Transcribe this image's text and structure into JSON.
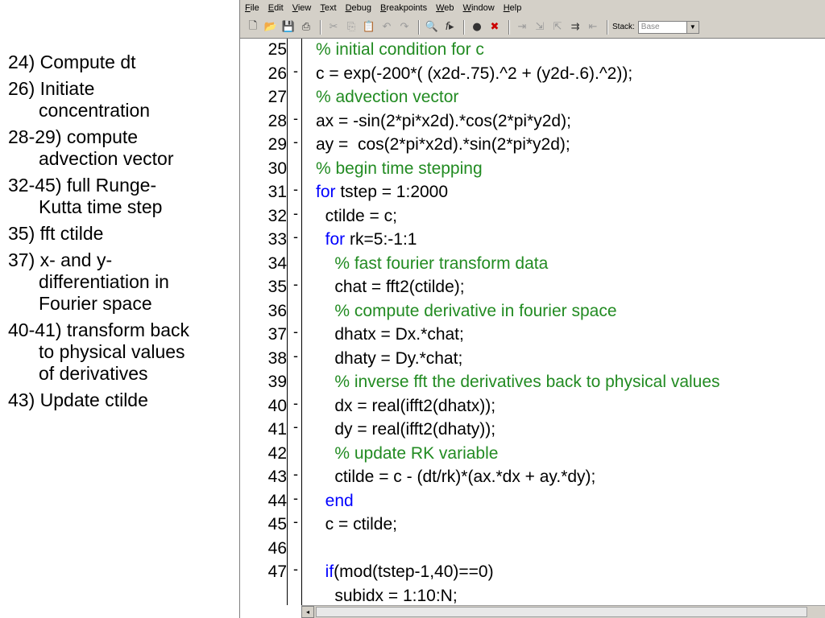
{
  "notes": [
    "24) Compute dt",
    "26) Initiate\nconcentration",
    "28-29) compute\nadvection vector",
    "32-45) full Runge-\nKutta time step",
    "35) fft ctilde",
    "37) x- and y-\ndifferentiation in\nFourier space",
    "40-41) transform back\nto physical values\nof derivatives",
    "43) Update ctilde"
  ],
  "menu": [
    "File",
    "Edit",
    "View",
    "Text",
    "Debug",
    "Breakpoints",
    "Web",
    "Window",
    "Help"
  ],
  "toolbar": {
    "icons": [
      "new-file-icon",
      "open-folder-icon",
      "save-icon",
      "print-icon",
      "cut-icon",
      "copy-icon",
      "paste-icon",
      "undo-icon",
      "redo-icon",
      "find-icon",
      "function-icon",
      "set-breakpoint-icon",
      "clear-breakpoint-icon",
      "step-icon",
      "step-in-icon",
      "step-out-icon",
      "continue-icon",
      "exit-debug-icon"
    ],
    "stack_label": "Stack:",
    "stack_value": "Base"
  },
  "code": {
    "lines": [
      {
        "n": "25",
        "mark": "",
        "text": "% initial condition for c",
        "kind": "comment"
      },
      {
        "n": "26",
        "mark": "-",
        "text": "c = exp(-200*( (x2d-.75).^2 + (y2d-.6).^2));",
        "kind": "code"
      },
      {
        "n": "27",
        "mark": "",
        "text": "% advection vector",
        "kind": "comment"
      },
      {
        "n": "28",
        "mark": "-",
        "text": "ax = -sin(2*pi*x2d).*cos(2*pi*y2d);",
        "kind": "code"
      },
      {
        "n": "29",
        "mark": "-",
        "text": "ay =  cos(2*pi*x2d).*sin(2*pi*y2d);",
        "kind": "code"
      },
      {
        "n": "30",
        "mark": "",
        "text": "% begin time stepping",
        "kind": "comment"
      },
      {
        "n": "31",
        "mark": "-",
        "kw": "for",
        "text": " tstep = 1:2000",
        "kind": "code"
      },
      {
        "n": "32",
        "mark": "-",
        "text": "  ctilde = c;",
        "kind": "code"
      },
      {
        "n": "33",
        "mark": "-",
        "kw": "  for",
        "text": " rk=5:-1:1",
        "kind": "code"
      },
      {
        "n": "34",
        "mark": "",
        "text": "    % fast fourier transform data",
        "kind": "comment"
      },
      {
        "n": "35",
        "mark": "-",
        "text": "    chat = fft2(ctilde);",
        "kind": "code"
      },
      {
        "n": "36",
        "mark": "",
        "text": "    % compute derivative in fourier space",
        "kind": "comment"
      },
      {
        "n": "37",
        "mark": "-",
        "text": "    dhatx = Dx.*chat;",
        "kind": "code"
      },
      {
        "n": "38",
        "mark": "-",
        "text": "    dhaty = Dy.*chat;",
        "kind": "code"
      },
      {
        "n": "39",
        "mark": "",
        "text": "    % inverse fft the derivatives back to physical values",
        "kind": "comment"
      },
      {
        "n": "40",
        "mark": "-",
        "text": "    dx = real(ifft2(dhatx));",
        "kind": "code"
      },
      {
        "n": "41",
        "mark": "-",
        "text": "    dy = real(ifft2(dhaty));",
        "kind": "code"
      },
      {
        "n": "42",
        "mark": "",
        "text": "    % update RK variable",
        "kind": "comment"
      },
      {
        "n": "43",
        "mark": "-",
        "text": "    ctilde = c - (dt/rk)*(ax.*dx + ay.*dy);",
        "kind": "code"
      },
      {
        "n": "44",
        "mark": "-",
        "kw": "  end",
        "text": "",
        "kind": "code"
      },
      {
        "n": "45",
        "mark": "-",
        "text": "  c = ctilde;",
        "kind": "code"
      },
      {
        "n": "46",
        "mark": "",
        "text": "",
        "kind": "code"
      },
      {
        "n": "47",
        "mark": "-",
        "kw": "  if",
        "text": "(mod(tstep-1,40)==0)",
        "kind": "code"
      },
      {
        "n": "",
        "mark": "",
        "text": "    subidx = 1:10:N;",
        "kind": "code"
      }
    ]
  }
}
